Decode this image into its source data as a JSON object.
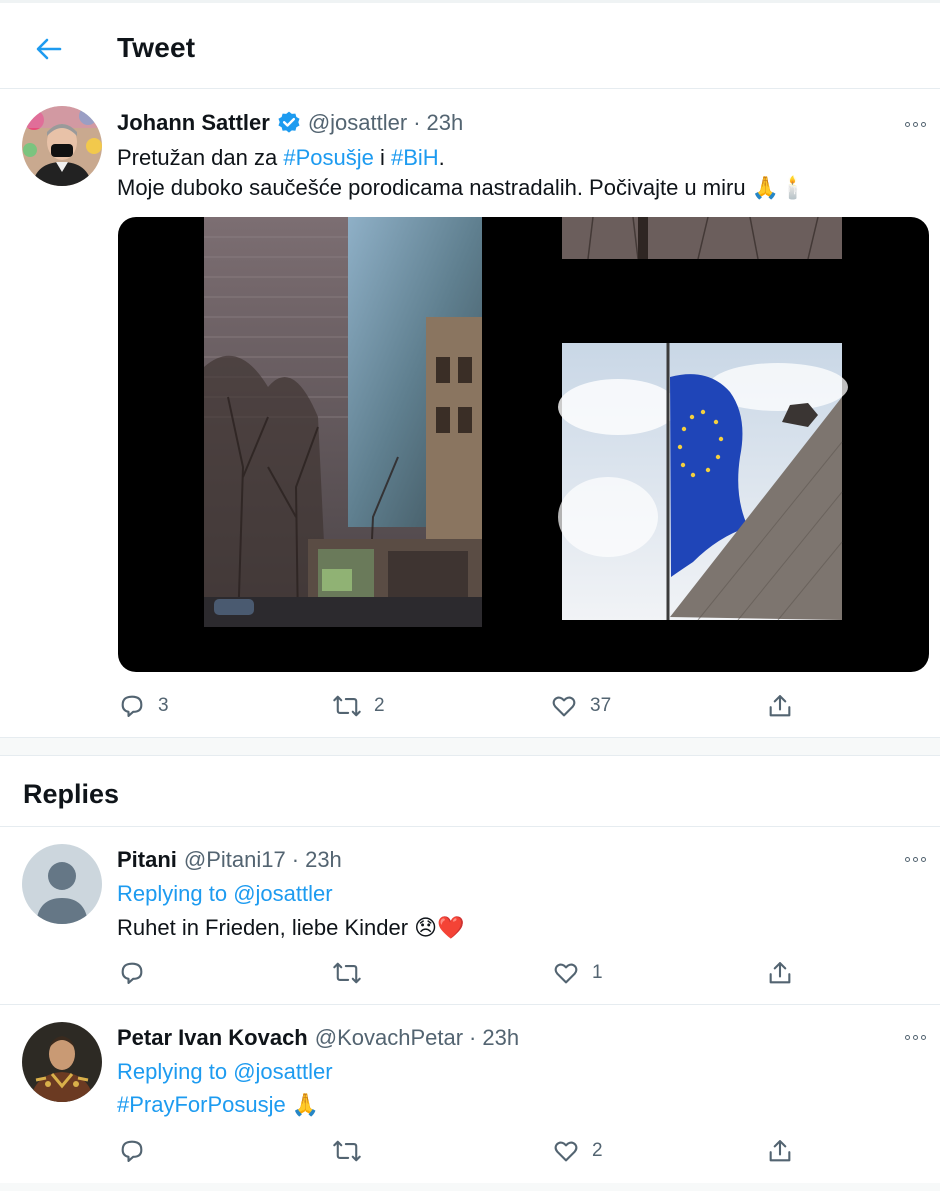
{
  "header": {
    "title": "Tweet"
  },
  "tweet": {
    "author_name": "Johann Sattler",
    "author_handle": "@josattler",
    "separator": "·",
    "time": "23h",
    "line1_prefix": "Pretužan dan za ",
    "hashtag1": "#Posušje",
    "line1_mid": " i ",
    "hashtag2": "#BiH",
    "line1_suffix": ".",
    "line2": "Moje duboko saučešće porodicama nastradalih.  Počivajte u miru 🙏🕯️",
    "stats": {
      "replies": "3",
      "retweets": "2",
      "likes": "37"
    }
  },
  "replies_section": {
    "title": "Replies"
  },
  "replies": [
    {
      "author_name": "Pitani",
      "author_handle": "@Pitani17",
      "separator": "·",
      "time": "23h",
      "replying_prefix": "Replying to ",
      "replying_handle": "@josattler",
      "text": "Ruhet in Frieden, liebe Kinder 😞❤️",
      "stats": {
        "replies": "",
        "retweets": "",
        "likes": "1"
      }
    },
    {
      "author_name": "Petar Ivan Kovach",
      "author_handle": "@KovachPetar",
      "separator": "·",
      "time": "23h",
      "replying_prefix": "Replying to ",
      "replying_handle": "@josattler",
      "hashtag": "#PrayForPosusje",
      "text_suffix": " 🙏",
      "stats": {
        "replies": "",
        "retweets": "",
        "likes": "2"
      }
    }
  ],
  "colors": {
    "accent": "#1d9bf0",
    "text": "#0f1419",
    "muted": "#536471",
    "eu_blue": "#1f45b8",
    "eu_gold": "#f4d03f"
  },
  "icons": [
    "back-arrow-icon",
    "verified-badge-icon",
    "more-icon",
    "reply-icon",
    "retweet-icon",
    "like-icon",
    "share-icon",
    "default-avatar-icon"
  ]
}
